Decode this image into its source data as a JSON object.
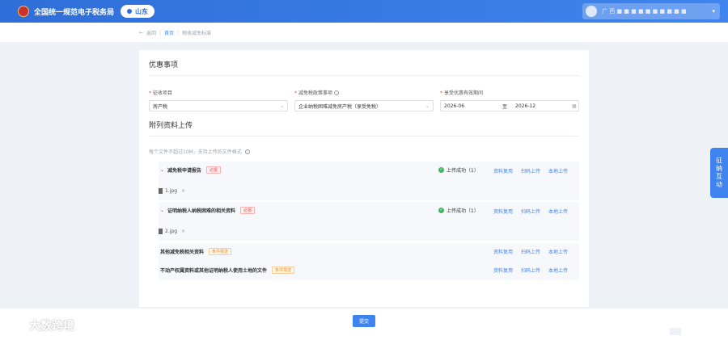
{
  "header": {
    "title": "全国统一规范电子税务局",
    "region": "山东",
    "user_name": "广 西 ■ ■ ■ ■ ■ ■ ■ ■ ■ ■"
  },
  "breadcrumb": {
    "back": "返回",
    "home": "首页",
    "current": "税收减免标准"
  },
  "section1": {
    "title": "优惠事项",
    "field1_label": "征收项目",
    "field1_value": "房产税",
    "field2_label": "减免税政策事项",
    "field2_value": "企业纳税困难减免房产税（享受免税）",
    "field3_label": "享受优惠有效期间",
    "date_start": "2026-06",
    "date_sep": "至",
    "date_end": "2026-12"
  },
  "section2": {
    "title": "附列资料上传",
    "hint": "每个文件不超过10M，支持上传的文件格式",
    "rows": [
      {
        "label": "减免税申请报告",
        "tag": "必报",
        "status": "上传成功（1）",
        "file": "1.jpg"
      },
      {
        "label": "证明纳税人纳税困难的相关资料",
        "tag": "必报",
        "status": "上传成功（1）",
        "file": "2.jpg"
      },
      {
        "label": "其他减免税相关资料",
        "tag": "条件报送"
      },
      {
        "label": "不动产权属资料或其他证明纳税人使用土地的文件",
        "tag": "条件报送"
      }
    ],
    "actions": {
      "reuse": "资料复用",
      "scan": "扫码上传",
      "local": "本地上传"
    },
    "remove": "×"
  },
  "submit_label": "提交",
  "side_tab": [
    "征",
    "纳",
    "互",
    "动"
  ],
  "watermark": "大数跨境",
  "colors": {
    "primary": "#3f84ee",
    "success": "#3cb65a",
    "danger": "#f04a4a",
    "warning": "#e8902a"
  }
}
